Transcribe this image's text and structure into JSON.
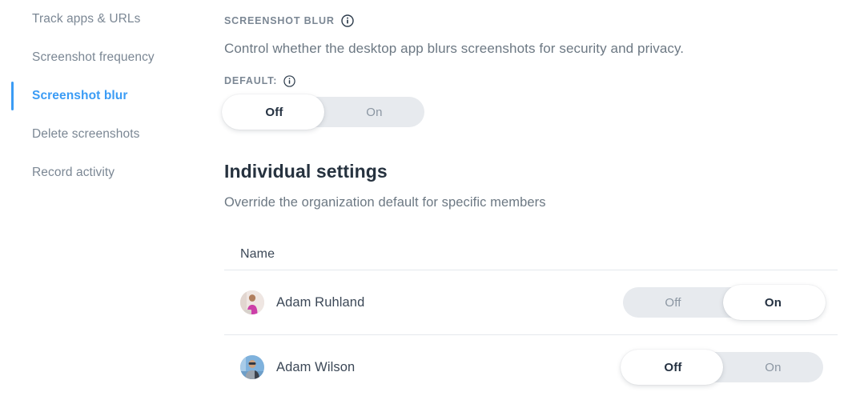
{
  "sidebar": {
    "items": [
      {
        "label": "Track apps & URLs",
        "active": false
      },
      {
        "label": "Screenshot frequency",
        "active": false
      },
      {
        "label": "Screenshot blur",
        "active": true
      },
      {
        "label": "Delete screenshots",
        "active": false
      },
      {
        "label": "Record activity",
        "active": false
      }
    ]
  },
  "main": {
    "section_label": "SCREENSHOT BLUR",
    "section_info_icon": "info-icon",
    "description": "Control whether the desktop app blurs screenshots for security and privacy.",
    "default_label": "DEFAULT:",
    "default_info_icon": "info-icon",
    "default_toggle": {
      "off_label": "Off",
      "on_label": "On",
      "state": "off"
    },
    "individual": {
      "heading": "Individual settings",
      "subtitle": "Override the organization default for specific members"
    },
    "table": {
      "columns": [
        "Name"
      ],
      "rows": [
        {
          "name": "Adam Ruhland",
          "avatar": "avatar-adam-ruhland",
          "toggle": {
            "off_label": "Off",
            "on_label": "On",
            "state": "on"
          }
        },
        {
          "name": "Adam Wilson",
          "avatar": "avatar-adam-wilson",
          "toggle": {
            "off_label": "Off",
            "on_label": "On",
            "state": "off"
          }
        }
      ]
    }
  },
  "colors": {
    "accent": "#3b9cf5",
    "muted_text": "#7b8794",
    "body_text": "#3c4857",
    "heading_text": "#26323f",
    "track": "#e7eaee",
    "divider": "#e4e8ed"
  }
}
